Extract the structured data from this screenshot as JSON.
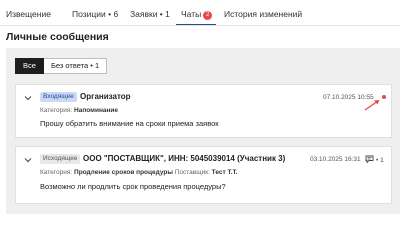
{
  "tabs": {
    "items": [
      {
        "label": "Извещение"
      },
      {
        "label": "Позиции • 6"
      },
      {
        "label": "Заявки • 1"
      },
      {
        "label": "Чаты",
        "badge": "2"
      },
      {
        "label": "История изменений"
      }
    ],
    "active_index": 3
  },
  "page_title": "Личные сообщения",
  "filters": {
    "all_label": "Все",
    "unanswered_label": "Без ответа • 1",
    "selected": "Все"
  },
  "messages": [
    {
      "direction": "Входящее",
      "sender": "Организатор",
      "category_label": "Категория:",
      "category_value": "Напоминание",
      "text": "Прошу обратить внимание на сроки приема заявок",
      "date": "07.10.2025 10:55",
      "unread": true
    },
    {
      "direction": "Исходящее",
      "sender": "ООО \"ПОСТАВЩИК\", ИНН: 5045039014 (Участник 3)",
      "category_label": "Категория:",
      "category_value": "Продление сроков процедуры",
      "supplier_label": "Поставщик:",
      "supplier_value": "Тест Т.Т.",
      "text": "Возможно ли продлить срок проведения процедуры?",
      "date": "03.10.2025 16:31",
      "replies": "1"
    }
  ],
  "icons": {
    "expand": "chevron-down-icon",
    "unread": "unread-dot-icon",
    "arrow": "arrow-pointer-icon",
    "replies": "chat-bubble-icon"
  },
  "colors": {
    "accent": "#2b4b8c",
    "badge_red": "#e5484d",
    "incoming_bg": "#c9d9f7",
    "outgoing_bg": "#e8e8e8",
    "panel_bg": "#efefef"
  }
}
